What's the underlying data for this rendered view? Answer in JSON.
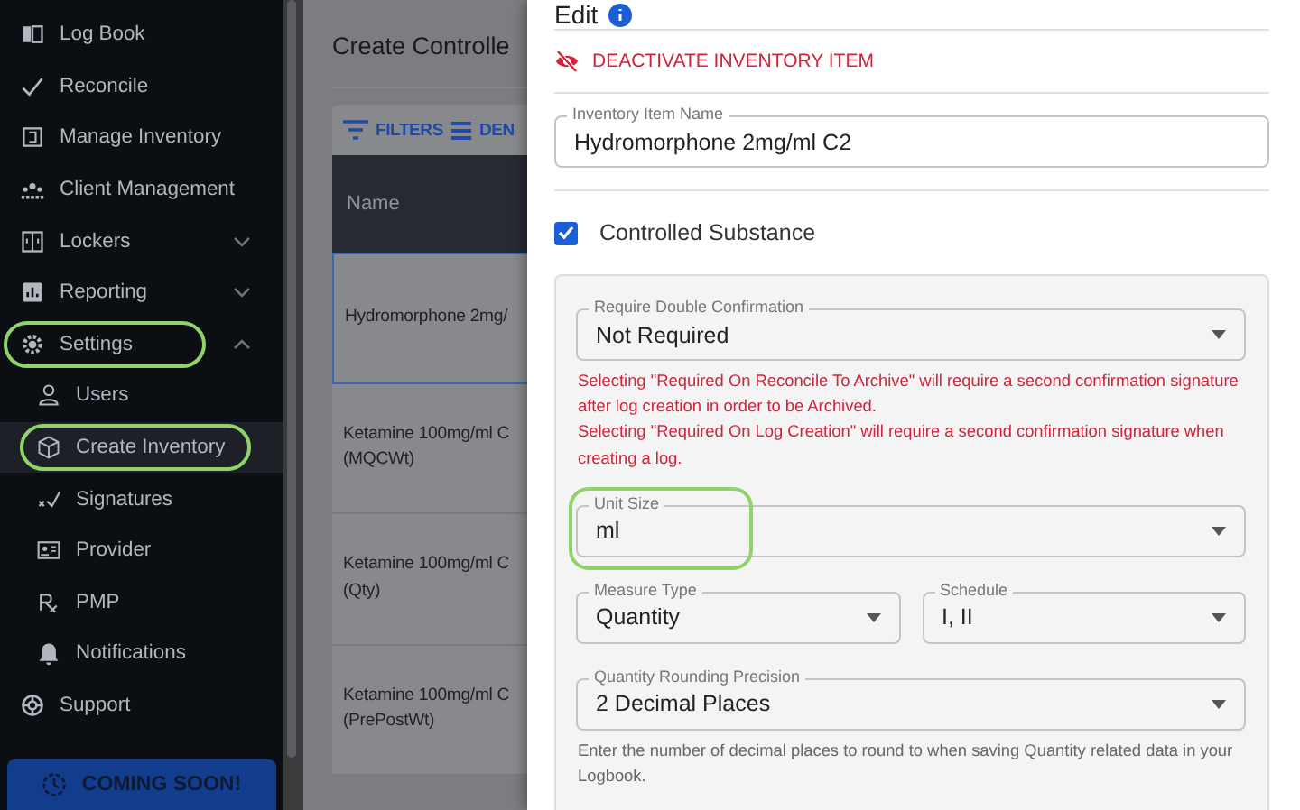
{
  "sidebar": {
    "items": [
      {
        "label": "Log Book",
        "selected": false,
        "highlighted": false
      },
      {
        "label": "Reconcile",
        "selected": false,
        "highlighted": false
      },
      {
        "label": "Manage Inventory",
        "selected": false,
        "highlighted": false
      },
      {
        "label": "Client Management",
        "selected": false,
        "highlighted": false
      },
      {
        "label": "Lockers",
        "selected": false,
        "highlighted": false,
        "expanded": false
      },
      {
        "label": "Reporting",
        "selected": false,
        "highlighted": false,
        "expanded": false
      },
      {
        "label": "Settings",
        "selected": false,
        "highlighted": true,
        "expanded": true,
        "children": [
          {
            "label": "Users",
            "selected": false,
            "highlighted": false
          },
          {
            "label": "Create Inventory",
            "selected": true,
            "highlighted": true
          },
          {
            "label": "Signatures",
            "selected": false,
            "highlighted": false
          },
          {
            "label": "Provider",
            "selected": false,
            "highlighted": false
          },
          {
            "label": "PMP",
            "selected": false,
            "highlighted": false
          },
          {
            "label": "Notifications",
            "selected": false,
            "highlighted": false
          }
        ]
      },
      {
        "label": "Support",
        "selected": false,
        "highlighted": false
      }
    ],
    "coming_soon_button": "COMING SOON!"
  },
  "main": {
    "title": "Create Controlle",
    "toolbar": [
      "FILTERS",
      "DEN"
    ],
    "table": {
      "columns": [
        "Name"
      ],
      "rows": [
        {
          "lines": [
            "Hydromorphone 2mg/"
          ],
          "selected": true
        },
        {
          "lines": [
            "Ketamine 100mg/ml C",
            "(MQCWt)"
          ],
          "selected": false
        },
        {
          "lines": [
            "Ketamine 100mg/ml C",
            "(Qty)"
          ],
          "selected": false
        },
        {
          "lines": [
            "Ketamine 100mg/ml C",
            "(PrePostWt)"
          ],
          "selected": false
        }
      ]
    }
  },
  "drawer": {
    "title": "Edit",
    "deactivate_button": "DEACTIVATE INVENTORY ITEM",
    "name_field": {
      "label": "Inventory Item Name",
      "value": "Hydromorphone 2mg/ml C2"
    },
    "controlled_substance": {
      "label": "Controlled Substance",
      "checked": true
    },
    "fields": [
      {
        "kind": "select",
        "label": "Require Double Confirmation",
        "value": "Not Required",
        "highlighted": false,
        "errors": [
          "Selecting \"Required On Reconcile To Archive\" will require a second confirmation signature after log creation in order to be Archived.",
          "Selecting \"Required On Log Creation\" will require a second confirmation signature when creating a log."
        ]
      },
      {
        "kind": "select",
        "label": "Unit Size",
        "value": "ml",
        "highlighted": true
      },
      {
        "kind": "pair",
        "items": [
          {
            "label": "Measure Type",
            "value": "Quantity"
          },
          {
            "label": "Schedule",
            "value": "I, II"
          }
        ]
      },
      {
        "kind": "select",
        "label": "Quantity Rounding Precision",
        "value": "2 Decimal Places",
        "highlighted": false,
        "helper": "Enter the number of decimal places to round to when saving Quantity related data in your Logbook."
      }
    ]
  }
}
